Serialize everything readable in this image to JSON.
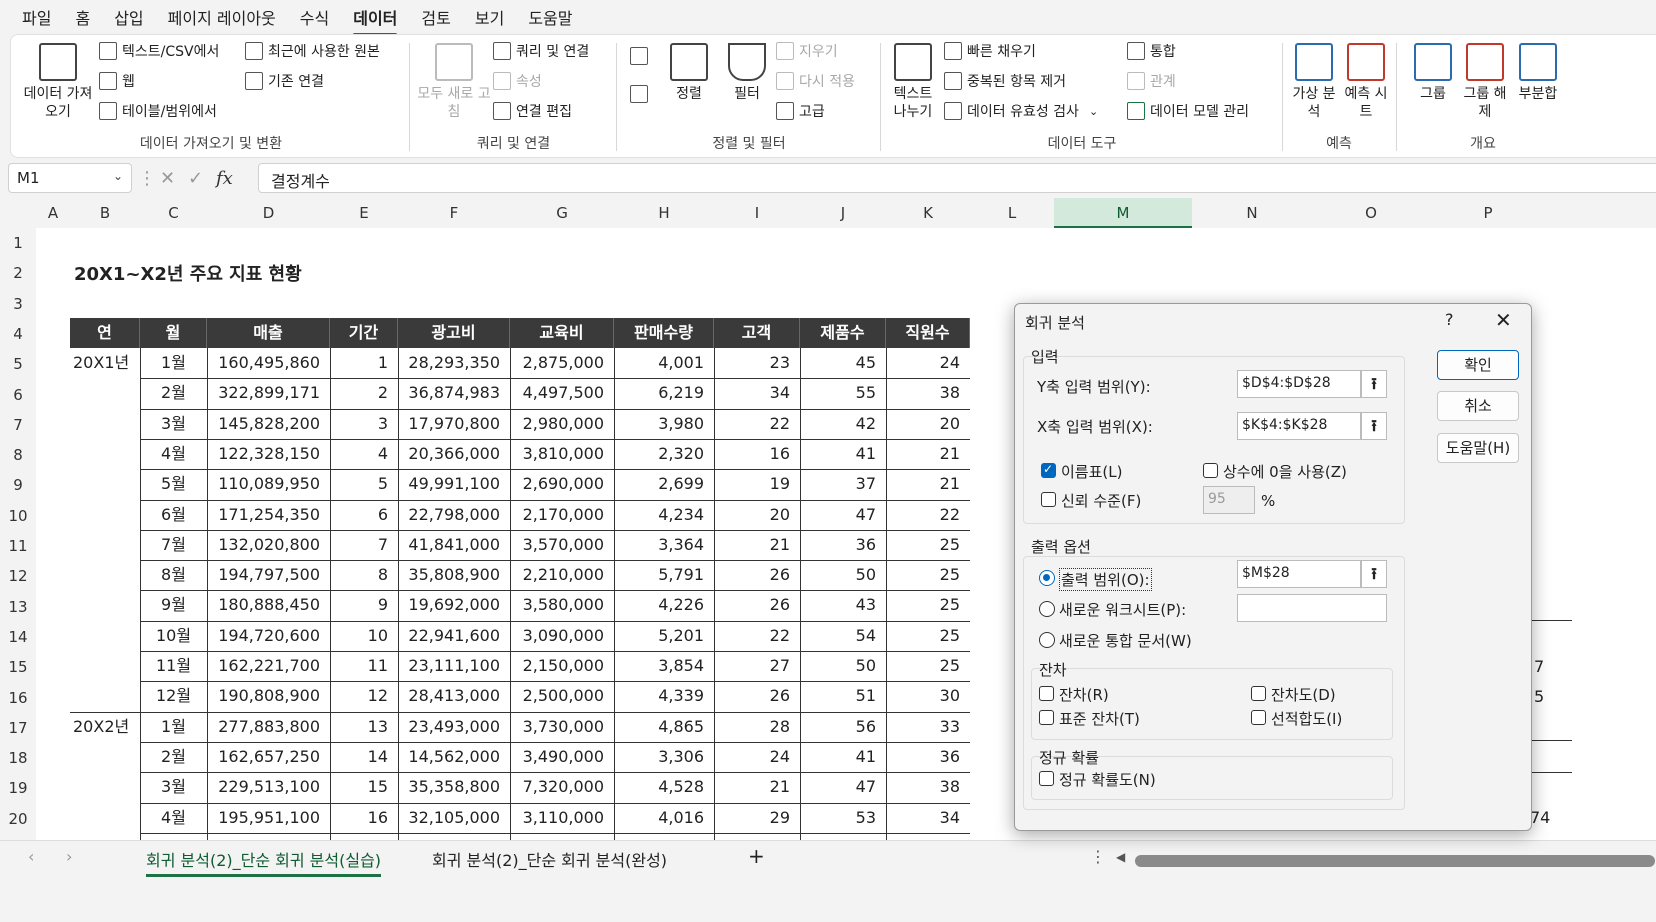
{
  "menu": [
    "파일",
    "홈",
    "삽입",
    "페이지 레이아웃",
    "수식",
    "데이터",
    "검토",
    "보기",
    "도움말"
  ],
  "menu_active": "데이터",
  "ribbon": {
    "get_data": "데이터 가져오기",
    "text_csv": "텍스트/CSV에서",
    "web": "웹",
    "table_range": "테이블/범위에서",
    "recent_sources": "최근에 사용한 원본",
    "existing_conn": "기존 연결",
    "group1": "데이터 가져오기 및 변환",
    "refresh_all": "모두 새로 고침",
    "queries_conn": "쿼리 및 연결",
    "properties": "속성",
    "edit_links": "연결 편집",
    "group2": "쿼리 및 연결",
    "sort": "정렬",
    "filter": "필터",
    "clear": "지우기",
    "reapply": "다시 적용",
    "advanced": "고급",
    "group3": "정렬 및 필터",
    "text_to_cols": "텍스트 나누기",
    "flash_fill": "빠른 채우기",
    "remove_dup": "중복된 항목 제거",
    "validation": "데이터 유효성 검사",
    "consolidate": "통합",
    "relationships": "관계",
    "data_model": "데이터 모델 관리",
    "group4": "데이터 도구",
    "whatif": "가상 분석",
    "forecast_sheet": "예측 시트",
    "group5": "예측",
    "group_btn": "그룹",
    "ungroup_btn": "그룹 해제",
    "subtotal": "부분합",
    "group6": "개요"
  },
  "formula_bar": {
    "name_box": "M1",
    "content": "결정계수"
  },
  "columns": [
    "A",
    "B",
    "C",
    "D",
    "E",
    "F",
    "G",
    "H",
    "I",
    "J",
    "K",
    "L",
    "M",
    "N",
    "O",
    "P"
  ],
  "rows": [
    "1",
    "2",
    "3",
    "4",
    "5",
    "6",
    "7",
    "8",
    "9",
    "10",
    "11",
    "12",
    "13",
    "14",
    "15",
    "16",
    "17",
    "18",
    "19",
    "20"
  ],
  "title": "20X1~X2년 주요 지표 현황",
  "table": {
    "headers": [
      "연",
      "월",
      "매출",
      "기간",
      "광고비",
      "교육비",
      "판매수량",
      "고객",
      "제품수",
      "직원수"
    ],
    "years": [
      "20X1년",
      "20X2년"
    ],
    "rows": [
      [
        "1월",
        "160,495,860",
        "1",
        "28,293,350",
        "2,875,000",
        "4,001",
        "23",
        "45",
        "24"
      ],
      [
        "2월",
        "322,899,171",
        "2",
        "36,874,983",
        "4,497,500",
        "6,219",
        "34",
        "55",
        "38"
      ],
      [
        "3월",
        "145,828,200",
        "3",
        "17,970,800",
        "2,980,000",
        "3,980",
        "22",
        "42",
        "20"
      ],
      [
        "4월",
        "122,328,150",
        "4",
        "20,366,000",
        "3,810,000",
        "2,320",
        "16",
        "41",
        "21"
      ],
      [
        "5월",
        "110,089,950",
        "5",
        "49,991,100",
        "2,690,000",
        "2,699",
        "19",
        "37",
        "21"
      ],
      [
        "6월",
        "171,254,350",
        "6",
        "22,798,000",
        "2,170,000",
        "4,234",
        "20",
        "47",
        "22"
      ],
      [
        "7월",
        "132,020,800",
        "7",
        "41,841,000",
        "3,570,000",
        "3,364",
        "21",
        "36",
        "25"
      ],
      [
        "8월",
        "194,797,500",
        "8",
        "35,808,900",
        "2,210,000",
        "5,791",
        "26",
        "50",
        "25"
      ],
      [
        "9월",
        "180,888,450",
        "9",
        "19,692,000",
        "3,580,000",
        "4,226",
        "26",
        "43",
        "25"
      ],
      [
        "10월",
        "194,720,600",
        "10",
        "22,941,600",
        "3,090,000",
        "5,201",
        "22",
        "54",
        "25"
      ],
      [
        "11월",
        "162,221,700",
        "11",
        "23,111,100",
        "2,150,000",
        "3,854",
        "27",
        "50",
        "25"
      ],
      [
        "12월",
        "190,808,900",
        "12",
        "28,413,000",
        "2,500,000",
        "4,339",
        "26",
        "51",
        "30"
      ],
      [
        "1월",
        "277,883,800",
        "13",
        "23,493,000",
        "3,730,000",
        "4,865",
        "28",
        "56",
        "33"
      ],
      [
        "2월",
        "162,657,250",
        "14",
        "14,562,000",
        "3,490,000",
        "3,306",
        "24",
        "41",
        "36"
      ],
      [
        "3월",
        "229,513,100",
        "15",
        "35,358,800",
        "7,320,000",
        "4,528",
        "21",
        "47",
        "38"
      ],
      [
        "4월",
        "195,951,100",
        "16",
        "32,105,000",
        "3,110,000",
        "4,016",
        "29",
        "53",
        "34"
      ]
    ]
  },
  "peek": {
    "p15": "7",
    "p16": "5",
    "p20": "74"
  },
  "dialog": {
    "title": "회귀 분석",
    "help": "?",
    "input_section": "입력",
    "y_label": "Y축 입력 범위(Y):",
    "y_value": "$D$4:$D$28",
    "x_label": "X축 입력 범위(X):",
    "x_value": "$K$4:$K$28",
    "labels": "이름표(L)",
    "constant_zero": "상수에 0을 사용(Z)",
    "confidence": "신뢰 수준(F)",
    "confidence_value": "95",
    "percent": "%",
    "output_section": "출력 옵션",
    "output_range": "출력 범위(O):",
    "output_value": "$M$28",
    "new_sheet": "새로운 워크시트(P):",
    "new_book": "새로운 통합 문서(W)",
    "residuals_section": "잔차",
    "residuals": "잔차(R)",
    "std_residuals": "표준 잔차(T)",
    "residual_plots": "잔차도(D)",
    "line_fit": "선적합도(I)",
    "normal_section": "정규 확률",
    "normal_plot": "정규 확률도(N)",
    "ok": "확인",
    "cancel": "취소",
    "help_btn": "도움말(H)"
  },
  "tabs": [
    "회귀 분석(2)_단순 회귀 분석(실습)",
    "회귀 분석(2)_단순 회귀 분석(완성)"
  ],
  "add_sheet": "+"
}
